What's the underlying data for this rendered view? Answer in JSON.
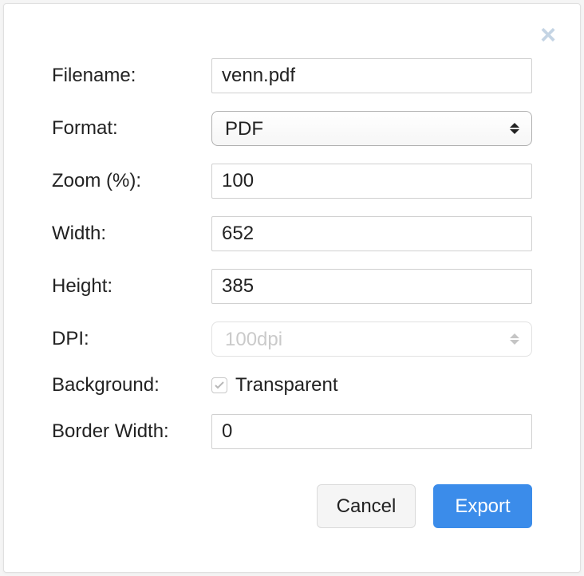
{
  "labels": {
    "filename": "Filename:",
    "format": "Format:",
    "zoom": "Zoom (%):",
    "width": "Width:",
    "height": "Height:",
    "dpi": "DPI:",
    "background": "Background:",
    "border_width": "Border Width:"
  },
  "values": {
    "filename": "venn.pdf",
    "format": "PDF",
    "zoom": "100",
    "width": "652",
    "height": "385",
    "dpi": "100dpi",
    "transparent_checked": true,
    "border_width": "0"
  },
  "checkbox": {
    "transparent": "Transparent"
  },
  "buttons": {
    "cancel": "Cancel",
    "export": "Export"
  }
}
